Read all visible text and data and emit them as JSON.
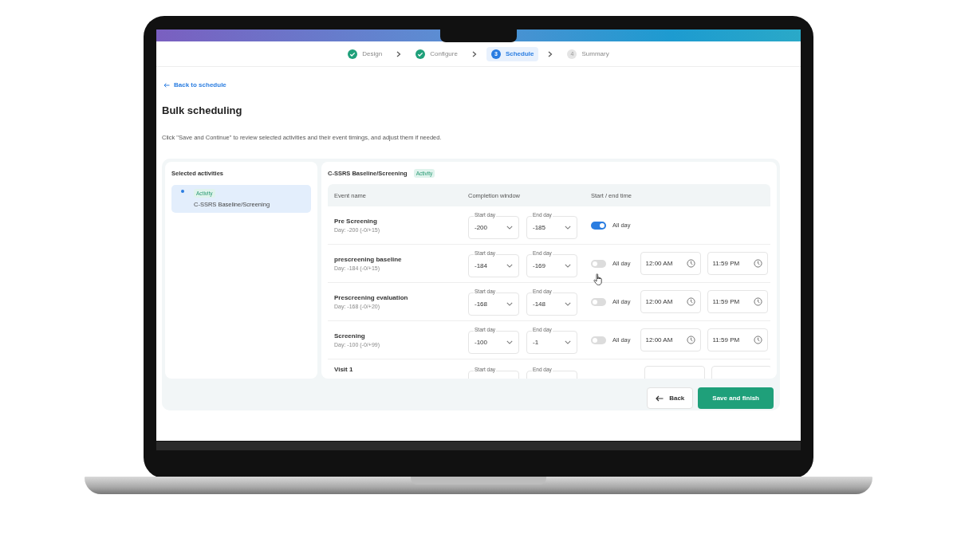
{
  "steps": [
    {
      "label": "Design",
      "completed": true,
      "selected": false
    },
    {
      "label": "Configure",
      "completed": true,
      "selected": false
    },
    {
      "label": "Schedule",
      "completed": false,
      "selected": true,
      "number": "3"
    },
    {
      "label": "Summary",
      "completed": false,
      "selected": false,
      "number": "4"
    }
  ],
  "back_link": "Back to schedule",
  "title": "Bulk scheduling",
  "description": "Click \"Save and Continue\" to review selected activities and their event timings, and adjust them if needed.",
  "sidebar": {
    "title": "Selected activities",
    "items": [
      {
        "tag": "Activity",
        "name": "C-SSRS Baseline/Screening",
        "selected": true
      }
    ]
  },
  "detail": {
    "title": "C-SSRS Baseline/Screening",
    "tag": "Activity",
    "columns": [
      "Event name",
      "Completion window",
      "Start / end time"
    ],
    "rows": [
      {
        "name": "Pre Screening",
        "day": "Day: -200 (-0/+15)",
        "start_label": "Start day",
        "start_day": "-200",
        "end_label": "End day",
        "end_day": "-185",
        "all_day": true,
        "all_day_label": "All day"
      },
      {
        "name": "prescreening baseline",
        "day": "Day: -184 (-0/+15)",
        "start_label": "Start day",
        "start_day": "-184",
        "end_label": "End day",
        "end_day": "-169",
        "all_day": false,
        "all_day_label": "All day",
        "start_time": "12:00 AM",
        "end_time": "11:59 PM"
      },
      {
        "name": "Prescreening evaluation",
        "day": "Day: -168 (-0/+20)",
        "start_label": "Start day",
        "start_day": "-168",
        "end_label": "End day",
        "end_day": "-148",
        "all_day": false,
        "all_day_label": "All day",
        "start_time": "12:00 AM",
        "end_time": "11:59 PM"
      },
      {
        "name": "Screening",
        "day": "Day: -100 (-0/+99)",
        "start_label": "Start day",
        "start_day": "-100",
        "end_label": "End day",
        "end_day": "-1",
        "all_day": false,
        "all_day_label": "All day",
        "start_time": "12:00 AM",
        "end_time": "11:59 PM"
      },
      {
        "name": "Visit 1",
        "start_label": "Start day",
        "end_label": "End day"
      }
    ]
  },
  "buttons": [
    {
      "label": "Back",
      "kind": "secondary"
    },
    {
      "label": "Save and finish",
      "kind": "primary"
    }
  ]
}
